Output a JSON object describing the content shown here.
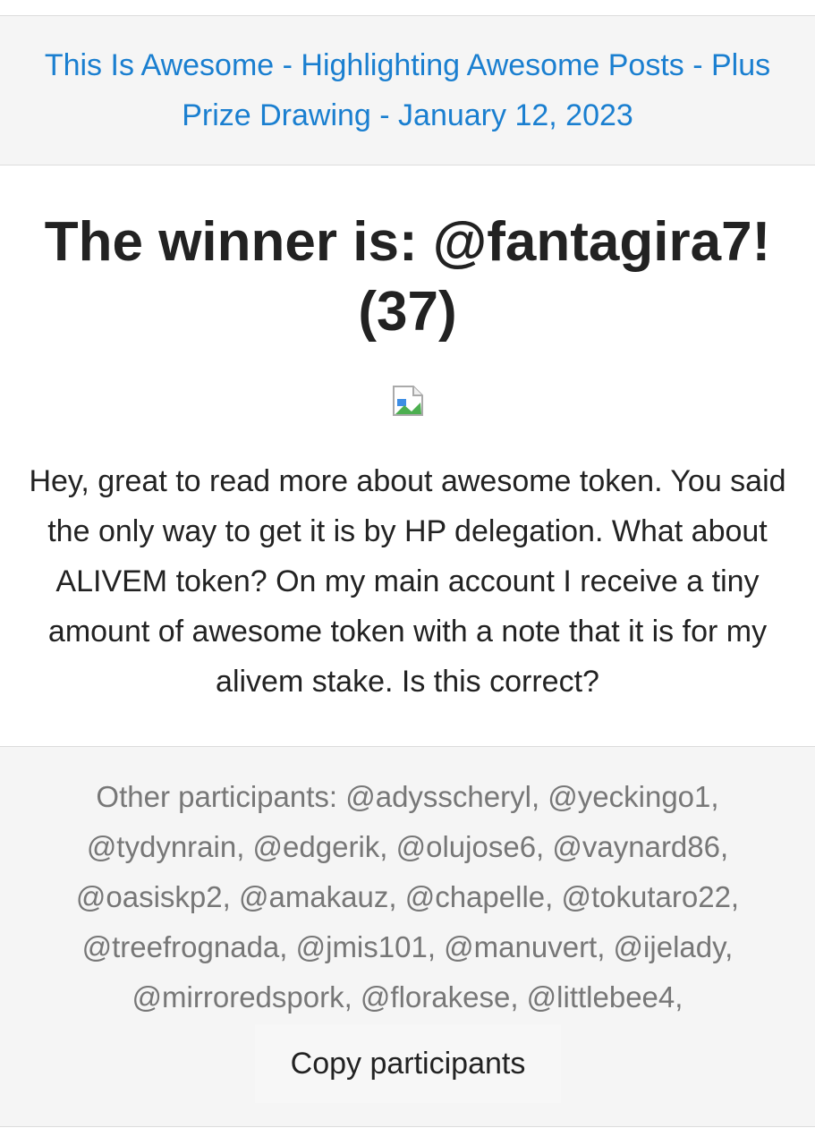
{
  "post": {
    "title": "This Is Awesome - Highlighting Awesome Posts - Plus Prize Drawing - January 12, 2023"
  },
  "winner": {
    "heading": "The winner is: @fantagira7! (37)"
  },
  "comment": {
    "text": "Hey, great to read more about awesome token. You said the only way to get it is by HP delegation. What about ALIVEM token? On my main account I receive a tiny amount of awesome token with a note that it is for my alivem stake. Is this correct?"
  },
  "participants": {
    "text": "Other participants: @adysscheryl, @yeckingo1, @tydynrain, @edgerik, @olujose6, @vaynard86, @oasiskp2, @amakauz, @chapelle, @tokutaro22, @treefrognada, @jmis101, @manuvert, @ijelady, @mirroredspork, @florakese, @littlebee4,",
    "copy_button_label": "Copy participants"
  },
  "colors": {
    "link": "#1a7fd0",
    "text": "#222222",
    "muted_text": "#777777",
    "panel_background": "#f5f5f5"
  },
  "icons": {
    "winner_image": "broken-image-icon"
  }
}
